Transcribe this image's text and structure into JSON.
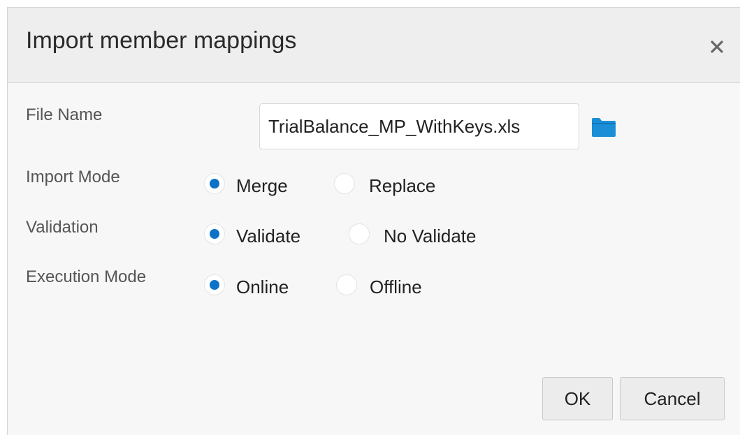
{
  "dialog": {
    "title": "Import member mappings"
  },
  "form": {
    "file_name": {
      "label": "File Name",
      "value": "TrialBalance_MP_WithKeys.xls"
    },
    "import_mode": {
      "label": "Import Mode",
      "options": [
        "Merge",
        "Replace"
      ],
      "selected": "Merge"
    },
    "validation": {
      "label": "Validation",
      "options": [
        "Validate",
        "No Validate"
      ],
      "selected": "Validate"
    },
    "execution_mode": {
      "label": "Execution Mode",
      "options": [
        "Online",
        "Offline"
      ],
      "selected": "Online"
    }
  },
  "buttons": {
    "ok": "OK",
    "cancel": "Cancel"
  },
  "colors": {
    "accent": "#0c72c6",
    "folder": "#1a8ed6"
  },
  "icons": {
    "close": "close-icon",
    "browse": "folder-icon"
  }
}
